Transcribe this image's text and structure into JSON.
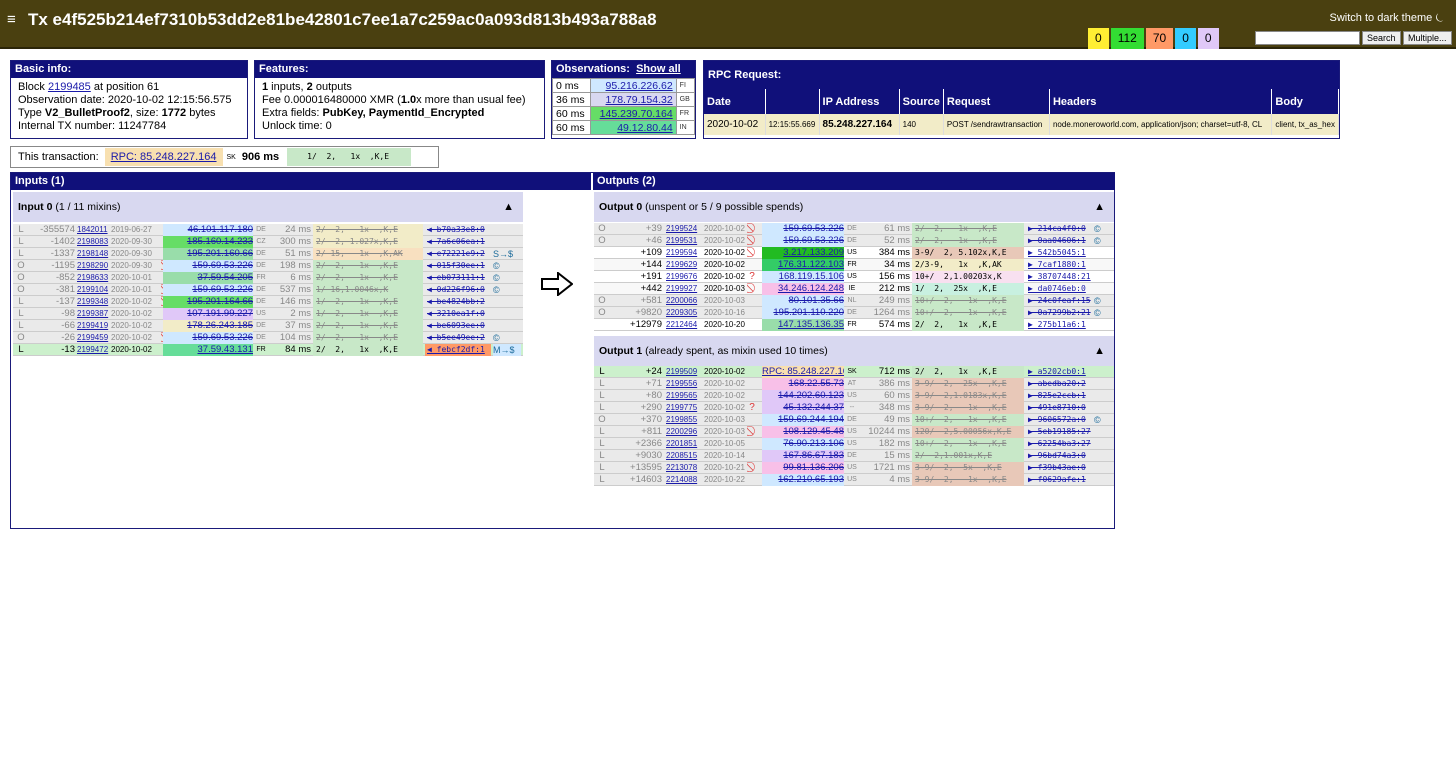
{
  "header": {
    "menu_icon": "≡",
    "title": "Tx e4f525b214ef7310b53dd2e81be42801c7ee1a7c259ac0a093d813b493a788a8",
    "theme_link": "Switch to dark theme ⏾",
    "search_label": "Search",
    "multiple_label": "Multiple...",
    "badges": [
      {
        "label": "0",
        "color": "#ffee33"
      },
      {
        "label": "112",
        "color": "#33dd33"
      },
      {
        "label": "70",
        "color": "#ff9966"
      },
      {
        "label": "0",
        "color": "#33ccff"
      },
      {
        "label": "0",
        "color": "#e0c8f8"
      }
    ]
  },
  "basic": {
    "title": "Basic info:",
    "block_prefix": "Block ",
    "block": "2199485",
    "block_suffix": " at position 61",
    "obs_line": "Observation date: 2020-10-02 12:15:56.575",
    "type_prefix": "Type ",
    "type": "V2_BulletProof2",
    "size_prefix": ", size: ",
    "size": "1772",
    "size_suffix": " bytes",
    "internal": "Internal TX number: 11247784"
  },
  "features": {
    "title": "Features:",
    "in_count": "1",
    "in_text": " inputs, ",
    "out_count": "2",
    "out_text": " outputs",
    "fee_prefix": "Fee 0.000016480000 XMR (",
    "fee_mult": "1.0",
    "fee_suffix": "x more than usual fee)",
    "extra_prefix": "Extra fields: ",
    "extra": "PubKey, PaymentId_Encrypted",
    "unlock": "Unlock time: 0"
  },
  "observations": {
    "title": "Observations:",
    "show_all": "Show all",
    "rows": [
      {
        "ms": "0 ms",
        "ip": "95.216.226.62",
        "cc": "FI",
        "color": "#cfe8ff"
      },
      {
        "ms": "36 ms",
        "ip": "178.79.154.32",
        "cc": "GB",
        "color": "#d8d8f0"
      },
      {
        "ms": "60 ms",
        "ip": "145.239.70.164",
        "cc": "FR",
        "color": "#66dd66"
      },
      {
        "ms": "60 ms",
        "ip": "49.12.80.44",
        "cc": "IN",
        "color": "#66dd99"
      }
    ]
  },
  "rpc": {
    "title": "RPC Request:",
    "headers": [
      "Date",
      "",
      "IP Address",
      "Source",
      "Request",
      "Headers",
      "Body"
    ],
    "row": [
      "2020-10-02",
      "12:15:55.669",
      "85.248.227.164",
      "140",
      "POST /sendrawtransaction",
      "node.moneroworld.com, application/json; charset=utf-8, CL",
      "client, tx_as_hex"
    ]
  },
  "this_tx": {
    "label": "This transaction:",
    "rpc": "RPC: 85.248.227.164",
    "cc": "SK",
    "ms": "906 ms",
    "sum": "1/  2,   1x  ,K,E"
  },
  "inputs": {
    "title": "Inputs (1)",
    "sub": "Input 0",
    "sub_extra": " (1 / 11 mixins)",
    "tri": "▲",
    "rows": [
      {
        "t": "L",
        "off": "-355574",
        "blk": "1842011",
        "date": "2019-06-27",
        "ban": "",
        "ip": "46.101.117.180",
        "cc": "DE",
        "ms": "24 ms",
        "sum": "2/  2,   1x  ,K,E",
        "hash": "b70a33e8:0",
        "ex": "",
        "faded": true,
        "ipbg": "#cfe8ff",
        "sumbg": "#f2ecc8"
      },
      {
        "t": "L",
        "off": "-1402",
        "blk": "2198083",
        "date": "2020-09-30",
        "ban": "",
        "ip": "185.160.14.233",
        "cc": "CZ",
        "ms": "300 ms",
        "sum": "2/  2, 1.027x,K,E",
        "hash": "7a6c06ea:1",
        "ex": "",
        "faded": true,
        "ipbg": "#66dd66",
        "sumbg": "#f2ecc8"
      },
      {
        "t": "L",
        "off": "-1337",
        "blk": "2198148",
        "date": "2020-09-30",
        "ban": "",
        "ip": "195.201.160.66",
        "cc": "DE",
        "ms": "51 ms",
        "sum": "2/ 15,   1x  ,K,AK",
        "hash": "e72221e9:2",
        "ex": "S→$",
        "faded": true,
        "ipbg": "#99ddaa",
        "sumbg": "#f8e0c0"
      },
      {
        "t": "O",
        "off": "-1195",
        "blk": "2198290",
        "date": "2020-09-30",
        "ban": "⃠",
        "ip": "159.69.53.226",
        "cc": "DE",
        "ms": "198 ms",
        "sum": "2/  2,   1x  ,K,E",
        "hash": "015f30ee:1",
        "ex": "©",
        "faded": true,
        "ipbg": "#cfe8ff",
        "sumbg": "#c8e8c8"
      },
      {
        "t": "O",
        "off": "-852",
        "blk": "2198633",
        "date": "2020-10-01",
        "ban": "",
        "ip": "37.59.54.205",
        "cc": "FR",
        "ms": "6 ms",
        "sum": "2/  2,   1x  ,K,E",
        "hash": "eb073111:1",
        "ex": "©",
        "faded": true,
        "ipbg": "#99ddaa",
        "sumbg": "#c8e8c8"
      },
      {
        "t": "O",
        "off": "-381",
        "blk": "2199104",
        "date": "2020-10-01",
        "ban": "⃠",
        "ip": "159.69.53.226",
        "cc": "DE",
        "ms": "537 ms",
        "sum": "1/ 16,1.0046x,K",
        "hash": "0d226f96:0",
        "ex": "©",
        "faded": true,
        "ipbg": "#cfe8ff",
        "sumbg": "#c8e8c8"
      },
      {
        "t": "L",
        "off": "-137",
        "blk": "2199348",
        "date": "2020-10-02",
        "ban": "⃠",
        "ip": "195.201.164.66",
        "cc": "DE",
        "ms": "146 ms",
        "sum": "1/  2,   1x  ,K,E",
        "hash": "be4824bb:2",
        "ex": "",
        "faded": true,
        "ipbg": "#66dd66",
        "sumbg": "#c8e8c8"
      },
      {
        "t": "L",
        "off": "-98",
        "blk": "2199387",
        "date": "2020-10-02",
        "ban": "",
        "ip": "107.191.99.227",
        "cc": "US",
        "ms": "2 ms",
        "sum": "1/  2,   1x  ,K,E",
        "hash": "3210ea1f:0",
        "ex": "",
        "faded": true,
        "ipbg": "#e0c8f8",
        "sumbg": "#c8e8c8"
      },
      {
        "t": "L",
        "off": "-66",
        "blk": "2199419",
        "date": "2020-10-02",
        "ban": "",
        "ip": "178.26.243.185",
        "cc": "DE",
        "ms": "37 ms",
        "sum": "2/  2,   1x  ,K,E",
        "hash": "be6093ee:0",
        "ex": "",
        "faded": true,
        "ipbg": "#f2ecc8",
        "sumbg": "#c8e8c8"
      },
      {
        "t": "O",
        "off": "-26",
        "blk": "2199459",
        "date": "2020-10-02",
        "ban": "⃠",
        "ip": "159.69.53.226",
        "cc": "DE",
        "ms": "104 ms",
        "sum": "2/  2,   1x  ,K,E",
        "hash": "b5ee49ee:2",
        "ex": "©",
        "faded": true,
        "ipbg": "#cfe8ff",
        "sumbg": "#c8e8c8"
      },
      {
        "t": "L",
        "off": "-13",
        "blk": "2199472",
        "date": "2020-10-02",
        "ban": "",
        "ip": "37.59.43.131",
        "cc": "FR",
        "ms": "84 ms",
        "sum": "2/  2,   1x  ,K,E",
        "hash": "febcf2df:1",
        "ex": "M→$",
        "faded": false,
        "ipbg": "#66dd99",
        "sumbg": "#c8e8c8",
        "hashbg": "#ff9966",
        "rowbg": "#ccf0cc",
        "exbg": "#cfe8ff"
      }
    ]
  },
  "arrow_icon": "⇨",
  "outputs": {
    "title": "Outputs (2)",
    "groups": [
      {
        "sub": "Output 0",
        "sub_extra": " (unspent or 5 / 9 possible spends)",
        "tri": "▲",
        "rows": [
          {
            "t": "O",
            "off": "+39",
            "blk": "2199524",
            "date": "2020-10-02",
            "ban": "⃠",
            "ip": "159.69.53.226",
            "cc": "DE",
            "ms": "61 ms",
            "sum": "2/  2,   1x  ,K,E",
            "hash": "214ca4f0:0",
            "ex": "©",
            "faded": true,
            "ipbg": "#cfe8ff",
            "sumbg": "#c8e8c8"
          },
          {
            "t": "O",
            "off": "+46",
            "blk": "2199531",
            "date": "2020-10-02",
            "ban": "⃠",
            "ip": "159.69.53.226",
            "cc": "DE",
            "ms": "52 ms",
            "sum": "2/  2,   1x  ,K,E",
            "hash": "0aa04606:1",
            "ex": "©",
            "faded": true,
            "ipbg": "#cfe8ff",
            "sumbg": "#c8e8c8"
          },
          {
            "t": "",
            "off": "+109",
            "blk": "2199594",
            "date": "2020-10-02",
            "ban": "⃠",
            "ip": "3.217.133.209",
            "cc": "US",
            "ms": "384 ms",
            "sum": "3-9/  2, 5.102x,K,E",
            "hash": "542b5045:1",
            "ex": "",
            "faded": false,
            "ipbg": "#22bb22",
            "sumbg": "#e8c8b8"
          },
          {
            "t": "",
            "off": "+144",
            "blk": "2199629",
            "date": "2020-10-02",
            "ban": "",
            "ip": "176.31.122.103",
            "cc": "FR",
            "ms": "34 ms",
            "sum": "2/3-9,   1x  ,K,AK",
            "hash": "7caf1880:1",
            "ex": "",
            "faded": false,
            "ipbg": "#33cc66",
            "sumbg": "#f2ecc8"
          },
          {
            "t": "",
            "off": "+191",
            "blk": "2199676",
            "date": "2020-10-02",
            "ban": "?",
            "ip": "168.119.15.106",
            "cc": "US",
            "ms": "156 ms",
            "sum": "10+/  2,1.00203x,K",
            "hash": "38707448:21",
            "ex": "",
            "faded": false,
            "ipbg": "#cfe8ff",
            "sumbg": "#f8e0f0"
          },
          {
            "t": "",
            "off": "+442",
            "blk": "2199927",
            "date": "2020-10-03",
            "ban": "⃠",
            "ip": "34.246.124.248",
            "cc": "IE",
            "ms": "212 ms",
            "sum": "1/  2,  25x  ,K,E",
            "hash": "da0746eb:0",
            "ex": "",
            "faded": false,
            "ipbg": "#f8c0e8",
            "sumbg": "#c8f0e0"
          },
          {
            "t": "O",
            "off": "+581",
            "blk": "2200066",
            "date": "2020-10-03",
            "ban": "",
            "ip": "80.101.35.66",
            "cc": "NL",
            "ms": "249 ms",
            "sum": "10+/  2,   1x  ,K,E",
            "hash": "24c0feaf:15",
            "ex": "©",
            "faded": true,
            "ipbg": "#cfe8ff",
            "sumbg": "#c8e8c8"
          },
          {
            "t": "O",
            "off": "+9820",
            "blk": "2209305",
            "date": "2020-10-16",
            "ban": "",
            "ip": "195.201.110.220",
            "cc": "DE",
            "ms": "1264 ms",
            "sum": "10+/  2,   1x  ,K,E",
            "hash": "0a7299b2:21",
            "ex": "©",
            "faded": true,
            "ipbg": "#cfe8ff",
            "sumbg": "#c8e8c8"
          },
          {
            "t": "",
            "off": "+12979",
            "blk": "2212464",
            "date": "2020-10-20",
            "ban": "",
            "ip": "147.135.136.35",
            "cc": "FR",
            "ms": "574 ms",
            "sum": "2/  2,   1x  ,K,E",
            "hash": "275b11a6:1",
            "ex": "",
            "faded": false,
            "ipbg": "#99ddaa",
            "sumbg": "#c8e8c8"
          }
        ]
      },
      {
        "sub": "Output 1",
        "sub_extra": " (already spent, as mixin used 10 times)",
        "tri": "▲",
        "rows": [
          {
            "t": "L",
            "off": "+24",
            "blk": "2199509",
            "date": "2020-10-02",
            "ban": "",
            "ip": "RPC: 85.248.227.164",
            "cc": "SK",
            "ms": "712 ms",
            "sum": "2/  2,   1x  ,K,E",
            "hash": "a5202cb0:1",
            "ex": "",
            "faded": false,
            "ipbg": "#f8e0b0",
            "sumbg": "#c8e8c8",
            "rowbg": "#ccf0cc"
          },
          {
            "t": "L",
            "off": "+71",
            "blk": "2199556",
            "date": "2020-10-02",
            "ban": "",
            "ip": "168.22.55.73",
            "cc": "AT",
            "ms": "386 ms",
            "sum": "3-9/  2,  25x  ,K,E",
            "hash": "abedba20:2",
            "ex": "",
            "faded": true,
            "ipbg": "#f8c0e8",
            "sumbg": "#e8c8b8"
          },
          {
            "t": "L",
            "off": "+80",
            "blk": "2199565",
            "date": "2020-10-02",
            "ban": "",
            "ip": "144.202.60.123",
            "cc": "US",
            "ms": "60 ms",
            "sum": "3-9/  2,1.0183x,K,E",
            "hash": "825e2ccb:1",
            "ex": "",
            "faded": true,
            "ipbg": "#e0c8f8",
            "sumbg": "#e8c8b8"
          },
          {
            "t": "L",
            "off": "+290",
            "blk": "2199775",
            "date": "2020-10-02",
            "ban": "?",
            "ip": "45.132.244.37",
            "cc": "--",
            "ms": "348 ms",
            "sum": "3-9/  2,   1x  ,K,E",
            "hash": "491e8710:0",
            "ex": "",
            "faded": true,
            "ipbg": "#e0c8f8",
            "sumbg": "#e8c8b8"
          },
          {
            "t": "O",
            "off": "+370",
            "blk": "2199855",
            "date": "2020-10-03",
            "ban": "",
            "ip": "159.69.244.194",
            "cc": "DE",
            "ms": "49 ms",
            "sum": "10+/  2,   1x  ,K,E",
            "hash": "9606572a:0",
            "ex": "©",
            "faded": true,
            "ipbg": "#cfe8ff",
            "sumbg": "#c8e8c8"
          },
          {
            "t": "L",
            "off": "+811",
            "blk": "2200296",
            "date": "2020-10-03",
            "ban": "⃠",
            "ip": "108.129.45.48",
            "cc": "US",
            "ms": "10244 ms",
            "sum": "120/  2,5.00056x,K,E",
            "hash": "5eb19185:27",
            "ex": "",
            "faded": true,
            "ipbg": "#f8c0e8",
            "sumbg": "#e8c8b8"
          },
          {
            "t": "L",
            "off": "+2366",
            "blk": "2201851",
            "date": "2020-10-05",
            "ban": "",
            "ip": "76.90.213.106",
            "cc": "US",
            "ms": "182 ms",
            "sum": "10+/  2,   1x  ,K,E",
            "hash": "62254ba3:27",
            "ex": "",
            "faded": true,
            "ipbg": "#cfe8ff",
            "sumbg": "#c8e8c8"
          },
          {
            "t": "L",
            "off": "+9030",
            "blk": "2208515",
            "date": "2020-10-14",
            "ban": "",
            "ip": "167.86.67.183",
            "cc": "DE",
            "ms": "15 ms",
            "sum": "2/  2,1.001x,K,E",
            "hash": "96bd74a3:0",
            "ex": "",
            "faded": true,
            "ipbg": "#e0c8f8",
            "sumbg": "#c8e8c8"
          },
          {
            "t": "L",
            "off": "+13595",
            "blk": "2213078",
            "date": "2020-10-21",
            "ban": "⃠",
            "ip": "99.81.136.206",
            "cc": "US",
            "ms": "1721 ms",
            "sum": "3-9/  2,  5x  ,K,E",
            "hash": "f39b43ae:0",
            "ex": "",
            "faded": true,
            "ipbg": "#f8c0e8",
            "sumbg": "#e8c8b8"
          },
          {
            "t": "L",
            "off": "+14603",
            "blk": "2214088",
            "date": "2020-10-22",
            "ban": "",
            "ip": "162.210.65.193",
            "cc": "US",
            "ms": "4 ms",
            "sum": "3-9/  2,   1x  ,K,E",
            "hash": "f0629afe:1",
            "ex": "",
            "faded": true,
            "ipbg": "#cfe8ff",
            "sumbg": "#e8c8b8"
          }
        ]
      }
    ]
  }
}
